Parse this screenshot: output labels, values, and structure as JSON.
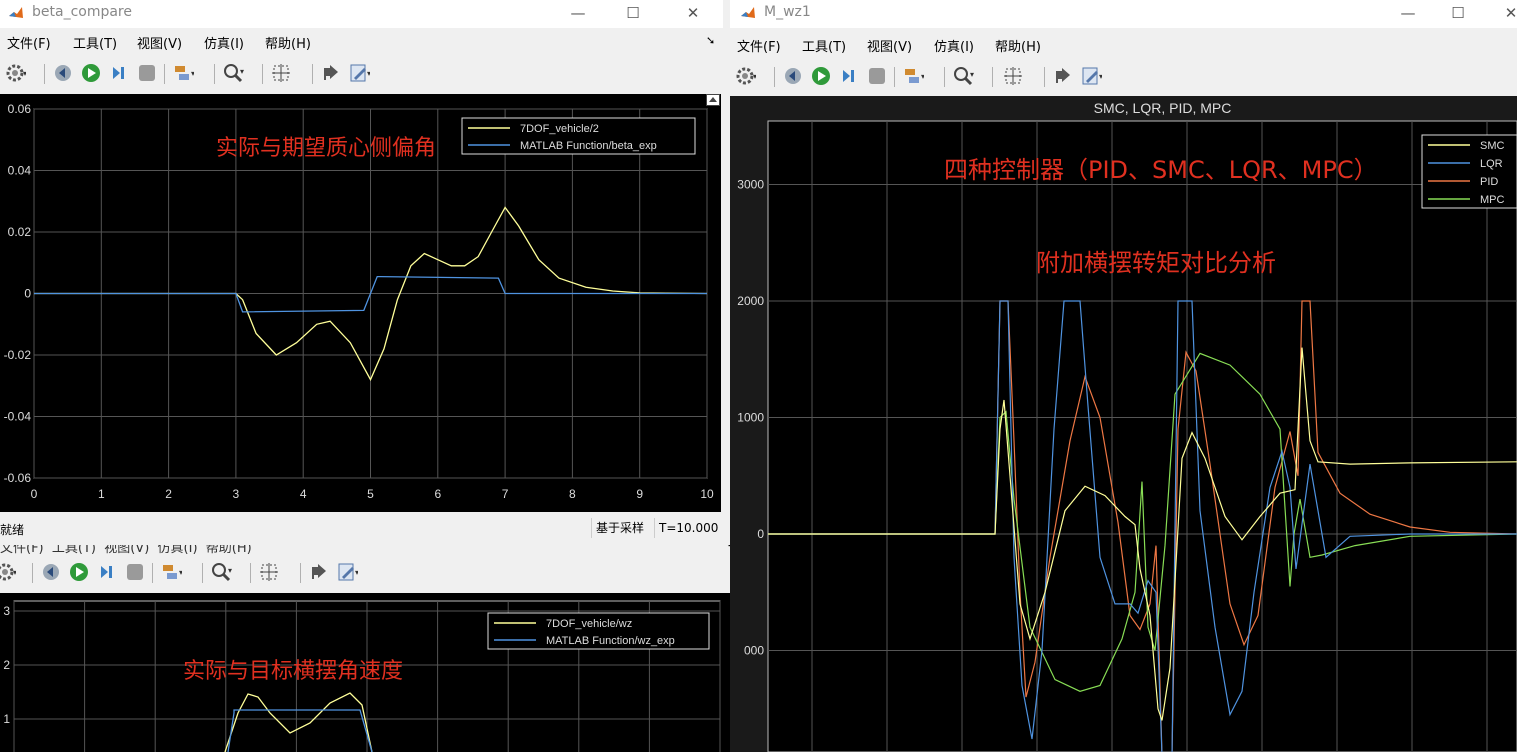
{
  "menu_labels": [
    "文件(F)",
    "工具(T)",
    "视图(V)",
    "仿真(I)",
    "帮助(H)"
  ],
  "beta_window": {
    "title": "beta_compare",
    "status_left": "就绪",
    "status_sample": "基于采样",
    "status_time": "T=10.000",
    "annotation": "实际与期望质心侧偏角"
  },
  "wz_window": {
    "annotation": "实际与目标横摆角速度",
    "menu_partial": "文件(F)  工具(T)  视图(V)  仿真(I)  帮助(H)"
  },
  "mwz_window": {
    "title": "M_wz1",
    "annotation1": "四种控制器（PID、SMC、LQR、MPC）",
    "annotation2": "附加横摆转矩对比分析"
  },
  "colors": {
    "scope_bg": "#000000",
    "grid": "#555555",
    "yellow": "#ffff99",
    "blue": "#4f93e0",
    "orange": "#ee7744",
    "green": "#88dd55",
    "annotation_red": "#e03020"
  },
  "chart_data": [
    {
      "type": "line",
      "title": "",
      "xlabel": "",
      "ylabel": "",
      "xlim": [
        0,
        10
      ],
      "ylim": [
        -0.06,
        0.06
      ],
      "x_ticks": [
        "0",
        "1",
        "2",
        "3",
        "4",
        "5",
        "6",
        "7",
        "8",
        "9",
        "10"
      ],
      "y_ticks": [
        "0.06",
        "0.04",
        "0.02",
        "0",
        "-0.02",
        "-0.04",
        "-0.06"
      ],
      "legend": "top-right",
      "grid": true,
      "series": [
        {
          "name": "7DOF_vehicle/2",
          "color": "#ffff99",
          "points": [
            [
              0,
              0
            ],
            [
              3.0,
              0
            ],
            [
              3.1,
              -0.002
            ],
            [
              3.3,
              -0.013
            ],
            [
              3.6,
              -0.02
            ],
            [
              3.9,
              -0.016
            ],
            [
              4.2,
              -0.01
            ],
            [
              4.4,
              -0.009
            ],
            [
              4.7,
              -0.016
            ],
            [
              5.0,
              -0.028
            ],
            [
              5.2,
              -0.018
            ],
            [
              5.4,
              -0.002
            ],
            [
              5.6,
              0.009
            ],
            [
              5.8,
              0.013
            ],
            [
              6.0,
              0.011
            ],
            [
              6.2,
              0.009
            ],
            [
              6.4,
              0.009
            ],
            [
              6.6,
              0.012
            ],
            [
              6.8,
              0.02
            ],
            [
              7.0,
              0.028
            ],
            [
              7.2,
              0.022
            ],
            [
              7.5,
              0.011
            ],
            [
              7.8,
              0.005
            ],
            [
              8.2,
              0.002
            ],
            [
              8.6,
              0.0008
            ],
            [
              9.0,
              0.0002
            ],
            [
              10,
              0
            ]
          ]
        },
        {
          "name": "MATLAB Function/beta_exp",
          "color": "#4f93e0",
          "points": [
            [
              0,
              0
            ],
            [
              3.0,
              0
            ],
            [
              3.1,
              -0.006
            ],
            [
              4.9,
              -0.0055
            ],
            [
              5.1,
              0.0055
            ],
            [
              6.9,
              0.005
            ],
            [
              7.0,
              0
            ],
            [
              10,
              0
            ]
          ]
        }
      ]
    },
    {
      "type": "line",
      "title": "",
      "xlabel": "",
      "ylabel": "",
      "xlim": [
        0,
        10
      ],
      "y_ticks": [
        "3",
        "2",
        "1"
      ],
      "legend": "top-right",
      "grid": true,
      "series": [
        {
          "name": "7DOF_vehicle/wz",
          "color": "#ffff99"
        },
        {
          "name": "MATLAB Function/wz_exp",
          "color": "#4f93e0"
        }
      ]
    },
    {
      "type": "line",
      "title": "SMC, LQR, PID, MPC",
      "xlabel": "",
      "ylabel": "",
      "y_ticks": [
        "3000",
        "2000",
        "1000",
        "0",
        "000"
      ],
      "legend": "top-right",
      "grid": true,
      "series": [
        {
          "name": "SMC",
          "color": "#ffff99"
        },
        {
          "name": "LQR",
          "color": "#4f93e0"
        },
        {
          "name": "PID",
          "color": "#ee7744"
        },
        {
          "name": "MPC",
          "color": "#88dd55"
        }
      ]
    }
  ]
}
